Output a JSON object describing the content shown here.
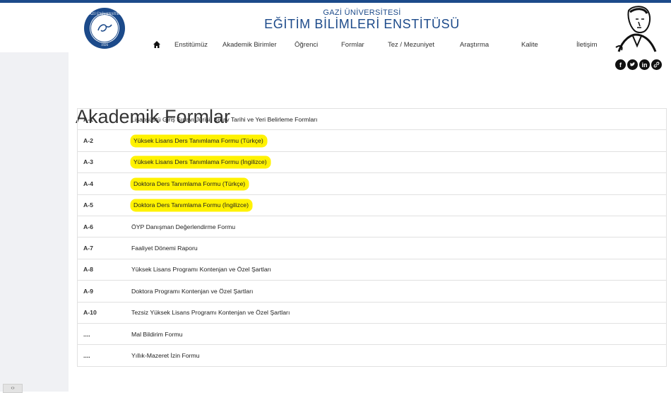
{
  "header": {
    "university": "GAZİ ÜNİVERSİTESİ",
    "institute": "EĞİTİM BİLİMLERİ ENSTİTÜSÜ",
    "logo_text": "GAZİ ÜNİVERSİTESİ",
    "logo_year": "1926"
  },
  "nav": {
    "home_icon": "home-icon",
    "items": [
      "Enstitümüz",
      "Akademik Birimler",
      "Öğrenci",
      "Formlar",
      "Tez / Mezuniyet",
      "Araştırma",
      "Kalite",
      "İletişim"
    ]
  },
  "social": [
    "facebook-icon",
    "twitter-icon",
    "linkedin-icon",
    "link-icon"
  ],
  "page": {
    "title": "Akademik Formlar"
  },
  "forms": [
    {
      "code": "A-1",
      "label": "Lisansüstü Giriş Sınavı Jürisi, Sınav Tarihi ve Yeri Belirleme Formları",
      "highlighted": false
    },
    {
      "code": "A-2",
      "label": "Yüksek Lisans Ders Tanımlama Formu (Türkçe)",
      "highlighted": true
    },
    {
      "code": "A-3",
      "label": "Yüksek Lisans Ders Tanımlama Formu (İngilizce)",
      "highlighted": true
    },
    {
      "code": "A-4",
      "label": "Doktora Ders Tanımlama Formu (Türkçe)",
      "highlighted": true
    },
    {
      "code": "A-5",
      "label": "Doktora Ders Tanımlama Formu (İngilizce)",
      "highlighted": true
    },
    {
      "code": "A-6",
      "label": "ÖYP Danışman Değerlendirme Formu",
      "highlighted": false
    },
    {
      "code": "A-7",
      "label": "Faaliyet Dönemi Raporu",
      "highlighted": false
    },
    {
      "code": "A-8",
      "label": "Yüksek Lisans Programı Kontenjan ve Özel Şartları",
      "highlighted": false
    },
    {
      "code": "A-9",
      "label": "Doktora Programı Kontenjan ve Özel Şartları",
      "highlighted": false
    },
    {
      "code": "A-10",
      "label": "Tezsiz Yüksek Lisans Programı Kontenjan ve Özel Şartları",
      "highlighted": false
    },
    {
      "code": "....",
      "label": "Mal Bildirim Formu",
      "highlighted": false
    },
    {
      "code": "....",
      "label": "Yıllık-Mazeret İzin Formu",
      "highlighted": false
    }
  ],
  "colors": {
    "brand": "#1c4a8a",
    "highlight": "#fff200"
  }
}
